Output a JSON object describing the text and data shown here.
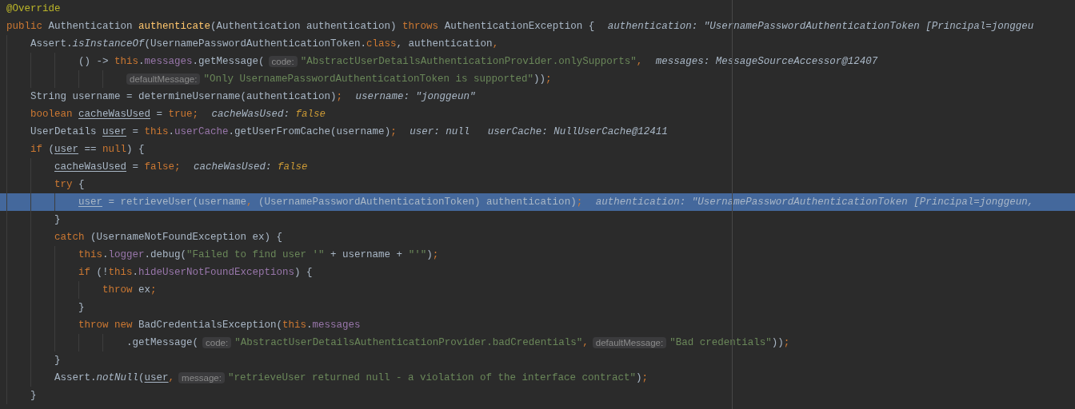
{
  "editor": {
    "lines": [
      {
        "current": false,
        "segments": [
          {
            "kind": "code",
            "tokens": [
              {
                "text": "@Override",
                "kind": "annotation"
              }
            ]
          }
        ]
      },
      {
        "current": false,
        "segments": [
          {
            "kind": "code",
            "tokens": [
              {
                "text": "public",
                "kind": "keyword"
              },
              {
                "text": " Authentication ",
                "kind": "plain"
              },
              {
                "text": "authenticate",
                "kind": "declaration"
              },
              {
                "text": "(Authentication authentication) ",
                "kind": "plain"
              },
              {
                "text": "throws",
                "kind": "keyword"
              },
              {
                "text": " AuthenticationException {",
                "kind": "plain"
              }
            ]
          },
          {
            "kind": "debug",
            "tokens": [
              {
                "text": "authentication: \"UsernamePasswordAuthenticationToken [Principal=jonggeu",
                "kind": "plain"
              }
            ]
          }
        ],
        "children": [
          {
            "current": false,
            "segments": [
              {
                "kind": "code",
                "tokens": [
                  {
                    "text": "Assert.",
                    "kind": "plain"
                  },
                  {
                    "text": "isInstanceOf",
                    "kind": "static"
                  },
                  {
                    "text": "(UsernamePasswordAuthenticationToken.",
                    "kind": "plain"
                  },
                  {
                    "text": "class",
                    "kind": "keyword"
                  },
                  {
                    "text": ", authentication",
                    "kind": "plain"
                  },
                  {
                    "text": ",",
                    "kind": "keyword"
                  }
                ]
              }
            ],
            "continuation": [
              {
                "current": false,
                "segments": [
                  {
                    "kind": "code",
                    "tokens": [
                      {
                        "text": "() -> ",
                        "kind": "plain"
                      },
                      {
                        "text": "this",
                        "kind": "keyword"
                      },
                      {
                        "text": ".",
                        "kind": "plain"
                      },
                      {
                        "text": "messages",
                        "kind": "field"
                      },
                      {
                        "text": ".getMessage(",
                        "kind": "plain"
                      }
                    ]
                  },
                  {
                    "kind": "hint",
                    "text": "code:"
                  },
                  {
                    "kind": "code",
                    "tokens": [
                      {
                        "text": "\"AbstractUserDetailsAuthenticationProvider.onlySupports\"",
                        "kind": "string"
                      },
                      {
                        "text": ",",
                        "kind": "keyword"
                      }
                    ]
                  },
                  {
                    "kind": "debug",
                    "tokens": [
                      {
                        "text": "messages: MessageSourceAccessor@12407",
                        "kind": "plain"
                      }
                    ]
                  }
                ],
                "continuation": [
                  {
                    "current": false,
                    "segments": [
                      {
                        "kind": "hint",
                        "text": "defaultMessage:"
                      },
                      {
                        "kind": "code",
                        "tokens": [
                          {
                            "text": "\"Only UsernamePasswordAuthenticationToken is supported\"",
                            "kind": "string"
                          },
                          {
                            "text": "))",
                            "kind": "plain"
                          },
                          {
                            "text": ";",
                            "kind": "keyword"
                          }
                        ]
                      }
                    ]
                  }
                ]
              }
            ]
          },
          {
            "current": false,
            "segments": [
              {
                "kind": "code",
                "tokens": [
                  {
                    "text": "String username = determineUsername(authentication)",
                    "kind": "plain"
                  },
                  {
                    "text": ";",
                    "kind": "keyword"
                  }
                ]
              },
              {
                "kind": "debug",
                "tokens": [
                  {
                    "text": "username: \"jonggeun\"",
                    "kind": "plain"
                  }
                ]
              }
            ]
          },
          {
            "current": false,
            "segments": [
              {
                "kind": "code",
                "tokens": [
                  {
                    "text": "boolean ",
                    "kind": "keyword"
                  },
                  {
                    "text": "cacheWasUsed",
                    "kind": "reassigned"
                  },
                  {
                    "text": " = ",
                    "kind": "plain"
                  },
                  {
                    "text": "true;",
                    "kind": "keyword"
                  }
                ]
              },
              {
                "kind": "debug",
                "tokens": [
                  {
                    "text": "cacheWasUsed: ",
                    "kind": "plain"
                  },
                  {
                    "text": "false",
                    "kind": "keyword"
                  }
                ]
              }
            ]
          },
          {
            "current": false,
            "segments": [
              {
                "kind": "code",
                "tokens": [
                  {
                    "text": "UserDetails ",
                    "kind": "plain"
                  },
                  {
                    "text": "user",
                    "kind": "reassigned"
                  },
                  {
                    "text": " = ",
                    "kind": "plain"
                  },
                  {
                    "text": "this",
                    "kind": "keyword"
                  },
                  {
                    "text": ".",
                    "kind": "plain"
                  },
                  {
                    "text": "userCache",
                    "kind": "field"
                  },
                  {
                    "text": ".getUserFromCache(username)",
                    "kind": "plain"
                  },
                  {
                    "text": ";",
                    "kind": "keyword"
                  }
                ]
              },
              {
                "kind": "debug",
                "tokens": [
                  {
                    "text": "user: null",
                    "kind": "plain"
                  }
                ]
              },
              {
                "kind": "debug",
                "tokens": [
                  {
                    "text": "userCache: NullUserCache@12411",
                    "kind": "plain"
                  }
                ]
              }
            ]
          },
          {
            "current": false,
            "segments": [
              {
                "kind": "code",
                "tokens": [
                  {
                    "text": "if",
                    "kind": "keyword"
                  },
                  {
                    "text": " (",
                    "kind": "plain"
                  },
                  {
                    "text": "user",
                    "kind": "reassigned"
                  },
                  {
                    "text": " == ",
                    "kind": "plain"
                  },
                  {
                    "text": "null",
                    "kind": "keyword"
                  },
                  {
                    "text": ") {",
                    "kind": "plain"
                  }
                ]
              }
            ],
            "children": [
              {
                "current": false,
                "segments": [
                  {
                    "kind": "code",
                    "tokens": [
                      {
                        "text": "cacheWasUsed",
                        "kind": "reassigned"
                      },
                      {
                        "text": " = ",
                        "kind": "plain"
                      },
                      {
                        "text": "false;",
                        "kind": "keyword"
                      }
                    ]
                  },
                  {
                    "kind": "debug",
                    "tokens": [
                      {
                        "text": "cacheWasUsed: ",
                        "kind": "plain"
                      },
                      {
                        "text": "false",
                        "kind": "keyword"
                      }
                    ]
                  }
                ]
              },
              {
                "current": false,
                "segments": [
                  {
                    "kind": "code",
                    "tokens": [
                      {
                        "text": "try",
                        "kind": "keyword"
                      },
                      {
                        "text": " {",
                        "kind": "plain"
                      }
                    ]
                  }
                ],
                "children": [
                  {
                    "current": true,
                    "segments": [
                      {
                        "kind": "code",
                        "tokens": [
                          {
                            "text": "user",
                            "kind": "reassigned"
                          },
                          {
                            "text": " = retrieveUser(username",
                            "kind": "plain"
                          },
                          {
                            "text": ",",
                            "kind": "keyword"
                          },
                          {
                            "text": " (UsernamePasswordAuthenticationToken) authentication)",
                            "kind": "plain"
                          },
                          {
                            "text": ";",
                            "kind": "keyword"
                          }
                        ]
                      },
                      {
                        "kind": "debug",
                        "tokens": [
                          {
                            "text": "authentication: \"UsernamePasswordAuthenticationToken [Principal=jonggeun,",
                            "kind": "plain"
                          }
                        ]
                      }
                    ]
                  }
                ]
              },
              {
                "current": false,
                "segments": [
                  {
                    "kind": "code",
                    "tokens": [
                      {
                        "text": "}",
                        "kind": "plain"
                      }
                    ]
                  }
                ]
              },
              {
                "current": false,
                "segments": [
                  {
                    "kind": "code",
                    "tokens": [
                      {
                        "text": "catch",
                        "kind": "keyword"
                      },
                      {
                        "text": " (UsernameNotFoundException ex) {",
                        "kind": "plain"
                      }
                    ]
                  }
                ],
                "children": [
                  {
                    "current": false,
                    "segments": [
                      {
                        "kind": "code",
                        "tokens": [
                          {
                            "text": "this",
                            "kind": "keyword"
                          },
                          {
                            "text": ".",
                            "kind": "plain"
                          },
                          {
                            "text": "logger",
                            "kind": "field"
                          },
                          {
                            "text": ".debug(",
                            "kind": "plain"
                          },
                          {
                            "text": "\"Failed to find user '\"",
                            "kind": "string"
                          },
                          {
                            "text": " + username + ",
                            "kind": "plain"
                          },
                          {
                            "text": "\"'\"",
                            "kind": "string"
                          },
                          {
                            "text": ")",
                            "kind": "plain"
                          },
                          {
                            "text": ";",
                            "kind": "keyword"
                          }
                        ]
                      }
                    ]
                  },
                  {
                    "current": false,
                    "segments": [
                      {
                        "kind": "code",
                        "tokens": [
                          {
                            "text": "if",
                            "kind": "keyword"
                          },
                          {
                            "text": " (!",
                            "kind": "plain"
                          },
                          {
                            "text": "this",
                            "kind": "keyword"
                          },
                          {
                            "text": ".",
                            "kind": "plain"
                          },
                          {
                            "text": "hideUserNotFoundExceptions",
                            "kind": "field"
                          },
                          {
                            "text": ") {",
                            "kind": "plain"
                          }
                        ]
                      }
                    ],
                    "children": [
                      {
                        "current": false,
                        "segments": [
                          {
                            "kind": "code",
                            "tokens": [
                              {
                                "text": "throw",
                                "kind": "keyword"
                              },
                              {
                                "text": " ex",
                                "kind": "plain"
                              },
                              {
                                "text": ";",
                                "kind": "keyword"
                              }
                            ]
                          }
                        ]
                      }
                    ]
                  },
                  {
                    "current": false,
                    "segments": [
                      {
                        "kind": "code",
                        "tokens": [
                          {
                            "text": "}",
                            "kind": "plain"
                          }
                        ]
                      }
                    ]
                  },
                  {
                    "current": false,
                    "segments": [
                      {
                        "kind": "code",
                        "tokens": [
                          {
                            "text": "throw new",
                            "kind": "keyword"
                          },
                          {
                            "text": " BadCredentialsException(",
                            "kind": "plain"
                          },
                          {
                            "text": "this",
                            "kind": "keyword"
                          },
                          {
                            "text": ".",
                            "kind": "plain"
                          },
                          {
                            "text": "messages",
                            "kind": "field"
                          }
                        ]
                      }
                    ],
                    "continuation": [
                      {
                        "current": false,
                        "segments": [
                          {
                            "kind": "code",
                            "tokens": [
                              {
                                "text": ".getMessage(",
                                "kind": "plain"
                              }
                            ]
                          },
                          {
                            "kind": "hint",
                            "text": "code:"
                          },
                          {
                            "kind": "code",
                            "tokens": [
                              {
                                "text": "\"AbstractUserDetailsAuthenticationProvider.badCredentials\"",
                                "kind": "string"
                              },
                              {
                                "text": ",",
                                "kind": "keyword"
                              }
                            ]
                          },
                          {
                            "kind": "hint",
                            "text": "defaultMessage:"
                          },
                          {
                            "kind": "code",
                            "tokens": [
                              {
                                "text": "\"Bad credentials\"",
                                "kind": "string"
                              },
                              {
                                "text": "))",
                                "kind": "plain"
                              },
                              {
                                "text": ";",
                                "kind": "keyword"
                              }
                            ]
                          }
                        ]
                      }
                    ]
                  }
                ]
              },
              {
                "current": false,
                "segments": [
                  {
                    "kind": "code",
                    "tokens": [
                      {
                        "text": "}",
                        "kind": "plain"
                      }
                    ]
                  }
                ]
              },
              {
                "current": false,
                "segments": [
                  {
                    "kind": "code",
                    "tokens": [
                      {
                        "text": "Assert.",
                        "kind": "plain"
                      },
                      {
                        "text": "notNull",
                        "kind": "static"
                      },
                      {
                        "text": "(",
                        "kind": "plain"
                      },
                      {
                        "text": "user",
                        "kind": "reassigned"
                      },
                      {
                        "text": ",",
                        "kind": "keyword"
                      }
                    ]
                  },
                  {
                    "kind": "hint",
                    "text": "message:"
                  },
                  {
                    "kind": "code",
                    "tokens": [
                      {
                        "text": "\"retrieveUser returned null - a violation of the interface contract\"",
                        "kind": "string"
                      },
                      {
                        "text": ")",
                        "kind": "plain"
                      },
                      {
                        "text": ";",
                        "kind": "keyword"
                      }
                    ]
                  }
                ]
              }
            ]
          },
          {
            "current": false,
            "segments": [
              {
                "kind": "code",
                "tokens": [
                  {
                    "text": "}",
                    "kind": "plain"
                  }
                ]
              }
            ]
          }
        ]
      }
    ]
  }
}
